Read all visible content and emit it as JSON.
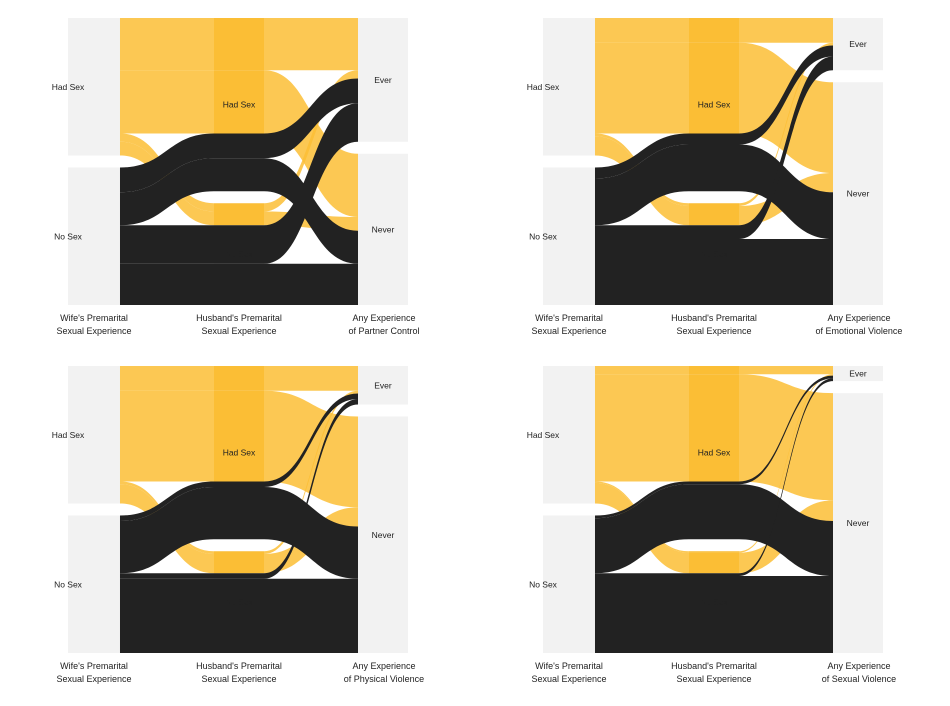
{
  "colors": {
    "had_sex": "#FBBE35",
    "no_sex": "#222222",
    "node": "#F2F2F2"
  },
  "chart_data": [
    {
      "type": "sankey",
      "stages": [
        "Wife's Premarital\nSexual Experience",
        "Husband's Premarital\nSexual Experience",
        "Any Experience\nof Partner Control"
      ],
      "stage_nodes": [
        [
          "Had Sex",
          "No Sex"
        ],
        [
          "Had Sex",
          "No Sex"
        ],
        [
          "Ever",
          "Never"
        ]
      ],
      "flows": [
        {
          "path": [
            "Had Sex",
            "Had Sex",
            "Ever"
          ],
          "value": 19
        },
        {
          "path": [
            "Had Sex",
            "Had Sex",
            "Never"
          ],
          "value": 23
        },
        {
          "path": [
            "Had Sex",
            "No Sex",
            "Ever"
          ],
          "value": 3
        },
        {
          "path": [
            "Had Sex",
            "No Sex",
            "Never"
          ],
          "value": 5
        },
        {
          "path": [
            "No Sex",
            "Had Sex",
            "Ever"
          ],
          "value": 9
        },
        {
          "path": [
            "No Sex",
            "Had Sex",
            "Never"
          ],
          "value": 12
        },
        {
          "path": [
            "No Sex",
            "No Sex",
            "Ever"
          ],
          "value": 14
        },
        {
          "path": [
            "No Sex",
            "No Sex",
            "Never"
          ],
          "value": 15
        }
      ]
    },
    {
      "type": "sankey",
      "stages": [
        "Wife's Premarital\nSexual Experience",
        "Husband's Premarital\nSexual Experience",
        "Any Experience\nof Emotional Violence"
      ],
      "stage_nodes": [
        [
          "Had Sex",
          "No Sex"
        ],
        [
          "Had Sex",
          "No Sex"
        ],
        [
          "Ever",
          "Never"
        ]
      ],
      "flows": [
        {
          "path": [
            "Had Sex",
            "Had Sex",
            "Ever"
          ],
          "value": 9
        },
        {
          "path": [
            "Had Sex",
            "Had Sex",
            "Never"
          ],
          "value": 33
        },
        {
          "path": [
            "Had Sex",
            "No Sex",
            "Ever"
          ],
          "value": 1
        },
        {
          "path": [
            "Had Sex",
            "No Sex",
            "Never"
          ],
          "value": 7
        },
        {
          "path": [
            "No Sex",
            "Had Sex",
            "Ever"
          ],
          "value": 4
        },
        {
          "path": [
            "No Sex",
            "Had Sex",
            "Never"
          ],
          "value": 17
        },
        {
          "path": [
            "No Sex",
            "No Sex",
            "Ever"
          ],
          "value": 5
        },
        {
          "path": [
            "No Sex",
            "No Sex",
            "Never"
          ],
          "value": 24
        }
      ]
    },
    {
      "type": "sankey",
      "stages": [
        "Wife's Premarital\nSexual Experience",
        "Husband's Premarital\nSexual Experience",
        "Any Experience\nof Physical Violence"
      ],
      "stage_nodes": [
        [
          "Had Sex",
          "No Sex"
        ],
        [
          "Had Sex",
          "No Sex"
        ],
        [
          "Ever",
          "Never"
        ]
      ],
      "flows": [
        {
          "path": [
            "Had Sex",
            "Had Sex",
            "Ever"
          ],
          "value": 9
        },
        {
          "path": [
            "Had Sex",
            "Had Sex",
            "Never"
          ],
          "value": 33
        },
        {
          "path": [
            "Had Sex",
            "No Sex",
            "Ever"
          ],
          "value": 1
        },
        {
          "path": [
            "Had Sex",
            "No Sex",
            "Never"
          ],
          "value": 7
        },
        {
          "path": [
            "No Sex",
            "Had Sex",
            "Ever"
          ],
          "value": 2
        },
        {
          "path": [
            "No Sex",
            "Had Sex",
            "Never"
          ],
          "value": 19
        },
        {
          "path": [
            "No Sex",
            "No Sex",
            "Ever"
          ],
          "value": 2
        },
        {
          "path": [
            "No Sex",
            "No Sex",
            "Never"
          ],
          "value": 27
        }
      ]
    },
    {
      "type": "sankey",
      "stages": [
        "Wife's Premarital\nSexual Experience",
        "Husband's Premarital\nSexual Experience",
        "Any Experience\nof Sexual Violence"
      ],
      "stage_nodes": [
        [
          "Had Sex",
          "No Sex"
        ],
        [
          "Had Sex",
          "No Sex"
        ],
        [
          "Ever",
          "Never"
        ]
      ],
      "flows": [
        {
          "path": [
            "Had Sex",
            "Had Sex",
            "Ever"
          ],
          "value": 3
        },
        {
          "path": [
            "Had Sex",
            "Had Sex",
            "Never"
          ],
          "value": 39
        },
        {
          "path": [
            "Had Sex",
            "No Sex",
            "Ever"
          ],
          "value": 0.5
        },
        {
          "path": [
            "Had Sex",
            "No Sex",
            "Never"
          ],
          "value": 7.5
        },
        {
          "path": [
            "No Sex",
            "Had Sex",
            "Ever"
          ],
          "value": 1
        },
        {
          "path": [
            "No Sex",
            "Had Sex",
            "Never"
          ],
          "value": 20
        },
        {
          "path": [
            "No Sex",
            "No Sex",
            "Ever"
          ],
          "value": 1
        },
        {
          "path": [
            "No Sex",
            "No Sex",
            "Never"
          ],
          "value": 28
        }
      ]
    }
  ]
}
